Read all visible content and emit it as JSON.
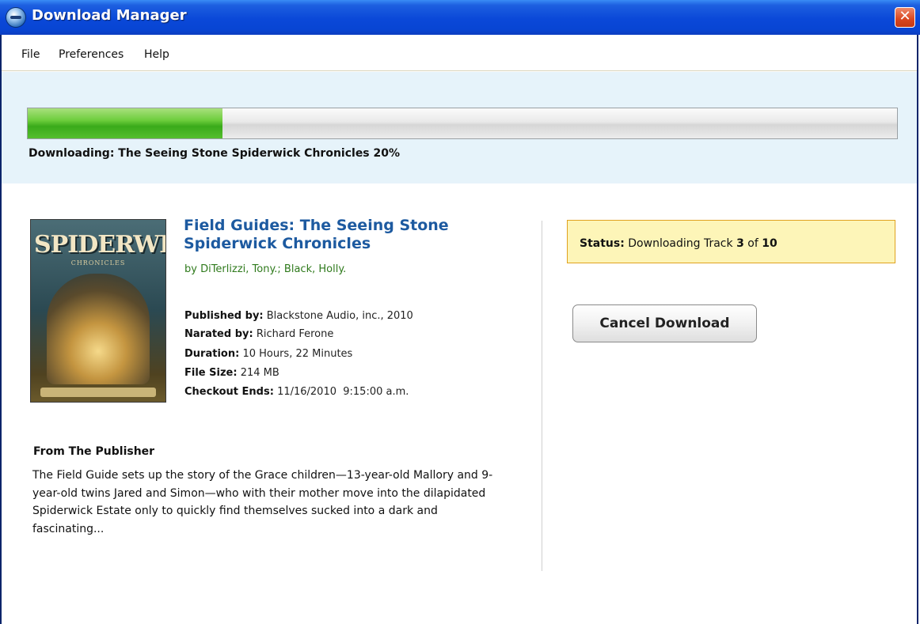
{
  "window": {
    "title": "Download Manager",
    "icon": "app-globe-icon",
    "close_icon": "close-icon",
    "close_glyph": "✕"
  },
  "menu": {
    "items": [
      "File",
      "Preferences",
      "Help"
    ]
  },
  "progress": {
    "prefix": "Downloading:",
    "item": "The Seeing Stone Spiderwick Chronicles",
    "percent_label": "20%",
    "fraction": 0.2,
    "fill_color": "#4cb928"
  },
  "book": {
    "cover": {
      "title_text": "SPIDERWICK",
      "subtitle_text": "CHRONICLES"
    },
    "title": "Field Guides: The Seeing Stone Spiderwick Chronicles",
    "authors": "by DiTerlizzi, Tony.; Black, Holly.",
    "details": [
      {
        "label": "Published by:",
        "value": "Blackstone Audio, inc., 2010"
      },
      {
        "label": "Narated by:",
        "value": "Richard Ferone"
      },
      {
        "label": "Duration:",
        "value": "10 Hours, 22 Minutes"
      },
      {
        "label": "File Size:",
        "value": "214 MB"
      },
      {
        "label": "Checkout Ends:",
        "value": "11/16/2010  9:15:00 a.m."
      }
    ]
  },
  "publisher": {
    "heading": "From The Publisher",
    "description": "The Field Guide sets up the story of the Grace children—13-year-old Mallory and 9-year-old twins Jared and Simon—who with their mother move into the dilapidated Spiderwick Estate only to quickly find themselves sucked into a dark and fascinating..."
  },
  "status": {
    "label": "Status:",
    "text_before": "Downloading Track",
    "current": "3",
    "of_text": "of",
    "total": "10"
  },
  "actions": {
    "cancel_label": "Cancel Download"
  },
  "colors": {
    "titlebar": "#0a48d8",
    "link_title": "#1d5aa0",
    "authors": "#2f7a1c",
    "progress_panel": "#e6f3fa",
    "status_bg": "#fdf5b8",
    "status_border": "#e0a21f"
  }
}
